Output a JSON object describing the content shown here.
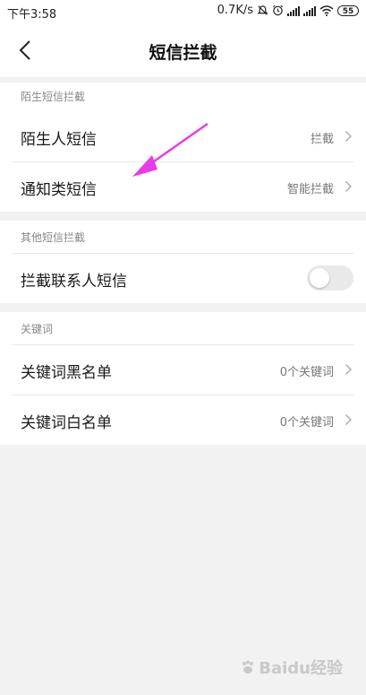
{
  "status_bar": {
    "time": "下午3:58",
    "network_speed": "0.7K/s",
    "battery": "55"
  },
  "header": {
    "title": "短信拦截"
  },
  "sections": [
    {
      "header": "陌生短信拦截",
      "items": [
        {
          "label": "陌生人短信",
          "value": "拦截"
        },
        {
          "label": "通知类短信",
          "value": "智能拦截"
        }
      ]
    },
    {
      "header": "其他短信拦截",
      "items": [
        {
          "label": "拦截联系人短信",
          "toggle": false
        }
      ]
    },
    {
      "header": "关键词",
      "items": [
        {
          "label": "关键词黑名单",
          "value": "0个关键词"
        },
        {
          "label": "关键词白名单",
          "value": "0个关键词"
        }
      ]
    }
  ],
  "annotation": {
    "arrow_color": "#e83ce8"
  },
  "watermark": {
    "text": "Baidu经验"
  }
}
